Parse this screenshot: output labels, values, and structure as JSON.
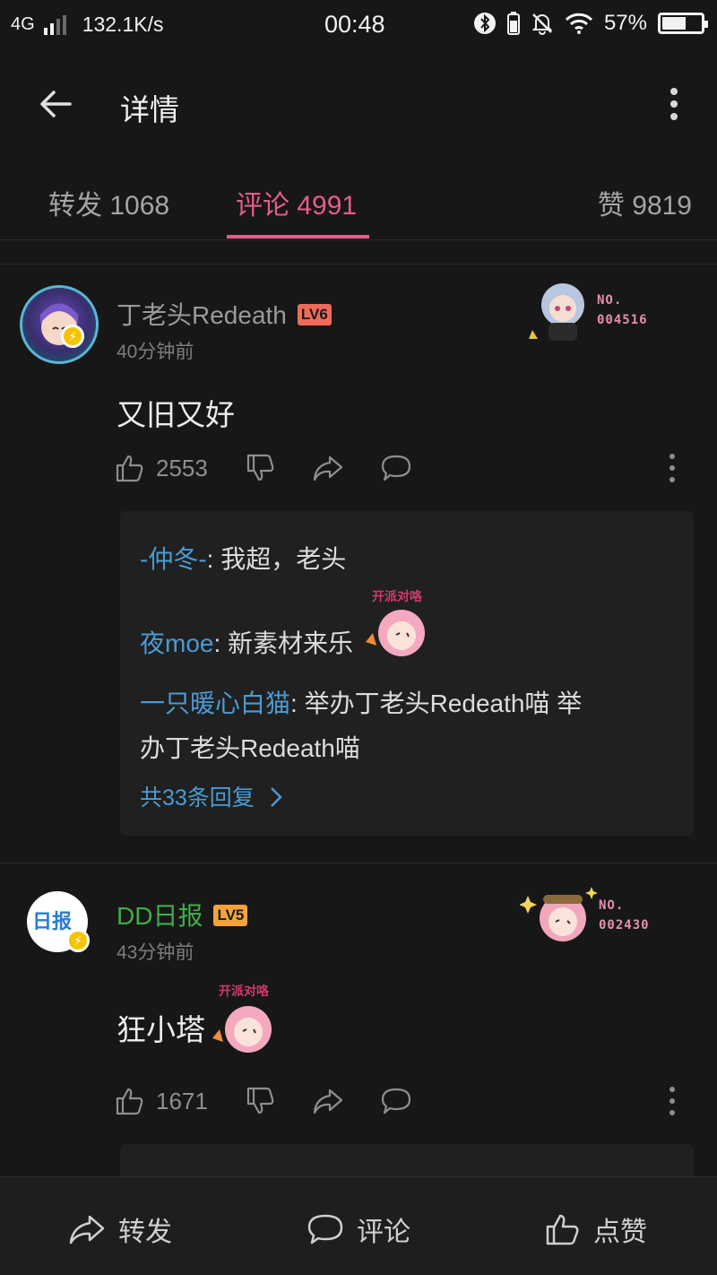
{
  "status_bar": {
    "network": "4G",
    "speed": "132.1K/s",
    "time": "00:48",
    "battery": "57%",
    "battery_level": 0.57
  },
  "header": {
    "title": "详情"
  },
  "tabs": [
    {
      "label": "转发 1068"
    },
    {
      "label": "评论 4991"
    },
    {
      "label": "赞 9819"
    }
  ],
  "comments": [
    {
      "username": "丁老头Redeath",
      "level": "LV6",
      "level_color": "#f06a5a",
      "time": "40分钟前",
      "text": "又旧又好",
      "likes": "2553",
      "badge_no": [
        "NO.",
        "004516"
      ],
      "replies": [
        {
          "name": "-仲冬-",
          "text": ": 我超，老头"
        },
        {
          "name": "夜moe",
          "text": ": 新素材来乐"
        },
        {
          "name": "一只暖心白猫",
          "text": ": 举办丁老头Redeath喵  举",
          "cont": "办丁老头Redeath喵"
        }
      ],
      "more_replies": "共33条回复"
    },
    {
      "username": "DD日报",
      "level": "LV5",
      "level_color": "#f2a33a",
      "username_color": "#3fae49",
      "time": "43分钟前",
      "text": "狂小塔",
      "likes": "1671",
      "badge_no": [
        "NO.",
        "002430"
      ],
      "sticker_text": "开派对咯",
      "avatar_text": "日报"
    }
  ],
  "sticker_text": "开派对咯",
  "bottom_bar": [
    {
      "label": "转发",
      "icon": "share-icon"
    },
    {
      "label": "评论",
      "icon": "comment-icon"
    },
    {
      "label": "点赞",
      "icon": "like-icon"
    }
  ]
}
